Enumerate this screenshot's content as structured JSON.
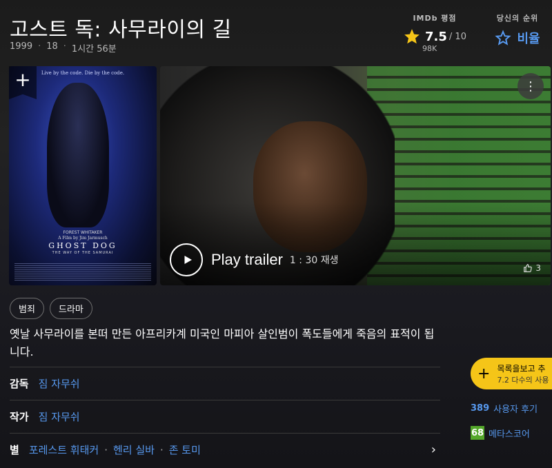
{
  "title": "고스트 독: 사무라이의 길",
  "meta": {
    "year": "1999",
    "rating": "18",
    "runtime": "1시간 56분"
  },
  "imdb": {
    "label": "IMDb 평점",
    "score": "7.5",
    "max": "/ 10",
    "count": "98K"
  },
  "your_rating": {
    "label": "당신의 순위",
    "action": "비율"
  },
  "poster": {
    "tagline": "Live by the code. Die by the code.",
    "actor": "FOREST WHITAKER",
    "film_by": "A Film by Jim Jarmusch",
    "title": "GHOST DOG",
    "subtitle": "THE WAY OF THE SAMURAI"
  },
  "video": {
    "play_label": "Play trailer",
    "duration": "1 : 30",
    "play_suffix": "재생",
    "likes": "3"
  },
  "genres": [
    "범죄",
    "드라마"
  ],
  "description": "옛날 사무라이를 본떠 만든 아프리카계 미국인 마피아 살인범이 폭도들에게 죽음의 표적이 됩니다.",
  "credits": {
    "director_label": "감독",
    "director": "짐 자무쉬",
    "writer_label": "작가",
    "writer": "짐 자무쉬",
    "stars_label": "별",
    "stars": [
      "포레스트 휘태커",
      "헨리 실바",
      "존 토미"
    ]
  },
  "watchlist": {
    "line1": "목록을보고 추",
    "line2": "7.2 다수의 사용"
  },
  "reviews": {
    "count": "389",
    "label": "사용자 후기"
  },
  "metascore": {
    "score": "68",
    "label": "메타스코어"
  },
  "colors": {
    "accent": "#f5c518",
    "link": "#5799ef",
    "meta_green": "#54a72a"
  }
}
